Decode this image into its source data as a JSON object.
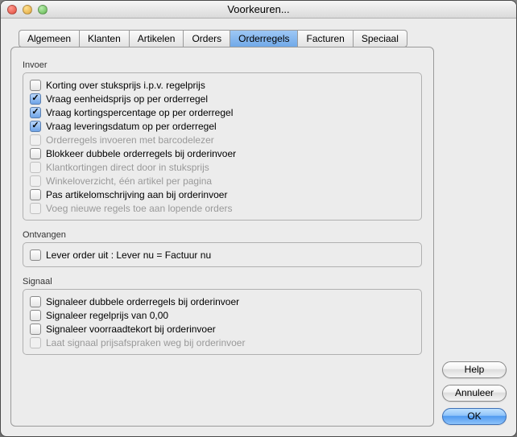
{
  "window": {
    "title": "Voorkeuren..."
  },
  "tabs": [
    {
      "label": "Algemeen",
      "active": false
    },
    {
      "label": "Klanten",
      "active": false
    },
    {
      "label": "Artikelen",
      "active": false
    },
    {
      "label": "Orders",
      "active": false
    },
    {
      "label": "Orderregels",
      "active": true
    },
    {
      "label": "Facturen",
      "active": false
    },
    {
      "label": "Speciaal",
      "active": false
    }
  ],
  "sections": {
    "invoer": {
      "title": "Invoer",
      "items": [
        {
          "label": "Korting over stuksprijs i.p.v. regelprijs",
          "checked": false,
          "disabled": false
        },
        {
          "label": "Vraag eenheidsprijs op per orderregel",
          "checked": true,
          "disabled": false
        },
        {
          "label": "Vraag kortingspercentage op per orderregel",
          "checked": true,
          "disabled": false
        },
        {
          "label": "Vraag leveringsdatum op per orderregel",
          "checked": true,
          "disabled": false
        },
        {
          "label": "Orderregels invoeren met barcodelezer",
          "checked": false,
          "disabled": true
        },
        {
          "label": "Blokkeer dubbele orderregels bij orderinvoer",
          "checked": false,
          "disabled": false
        },
        {
          "label": "Klantkortingen direct door in stuksprijs",
          "checked": false,
          "disabled": true
        },
        {
          "label": "Winkeloverzicht, één artikel per pagina",
          "checked": false,
          "disabled": true
        },
        {
          "label": "Pas artikelomschrijving aan bij orderinvoer",
          "checked": false,
          "disabled": false
        },
        {
          "label": "Voeg nieuwe regels toe aan lopende orders",
          "checked": false,
          "disabled": true
        }
      ]
    },
    "ontvangen": {
      "title": "Ontvangen",
      "items": [
        {
          "label": "Lever order uit : Lever nu = Factuur nu",
          "checked": false,
          "disabled": false
        }
      ]
    },
    "signaal": {
      "title": "Signaal",
      "items": [
        {
          "label": "Signaleer dubbele orderregels bij orderinvoer",
          "checked": false,
          "disabled": false
        },
        {
          "label": "Signaleer regelprijs van 0,00",
          "checked": false,
          "disabled": false
        },
        {
          "label": "Signaleer voorraadtekort bij orderinvoer",
          "checked": false,
          "disabled": false
        },
        {
          "label": "Laat signaal prijsafspraken weg bij orderinvoer",
          "checked": false,
          "disabled": true
        }
      ]
    }
  },
  "buttons": {
    "help": "Help",
    "cancel": "Annuleer",
    "ok": "OK"
  }
}
